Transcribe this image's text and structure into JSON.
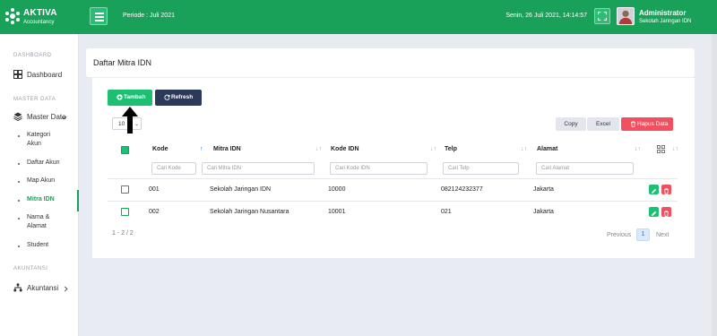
{
  "app": {
    "brand_name": "AKTIVA",
    "brand_sub": "Accountancy",
    "period": "Periode : Juli 2021",
    "datetime": "Senin, 26 Juli 2021, 14:14:57",
    "user_name": "Administrator",
    "user_org": "Sekolah Jaringan IDN",
    "accent_color": "#19a15a"
  },
  "sidebar": {
    "sections": [
      "DASHBOARD",
      "MASTER DATA",
      "AKUNTANSI"
    ],
    "dashboard_label": "Dashboard",
    "master_data_label": "Master Data",
    "sub_items": [
      "Kategori Akun",
      "Daftar Akun",
      "Map Akun",
      "Mitra IDN",
      "Nama & Alamat",
      "Student"
    ],
    "active_item": "Mitra IDN",
    "akuntansi_label": "Akuntansi"
  },
  "page": {
    "title": "Daftar Mitra IDN"
  },
  "toolbar": {
    "add_label": "Tambah",
    "refresh_label": "Refresh",
    "page_length": "10",
    "copy_label": "Copy",
    "excel_label": "Excel",
    "delete_label": "Hapus Data"
  },
  "table": {
    "columns": [
      "Kode",
      "Mitra IDN",
      "Kode IDN",
      "Telp",
      "Alamat"
    ],
    "filters": [
      "Cari Kode",
      "Cari Mitra IDN",
      "Cari Kode IDN",
      "Cari Telp",
      "Cari Alamat"
    ],
    "rows": [
      {
        "kode": "001",
        "mitra": "Sekolah Jaringan IDN",
        "kode_idn": "10000",
        "telp": "082124232377",
        "alamat": "Jakarta"
      },
      {
        "kode": "002",
        "mitra": "Sekolah Jaringan Nusantara",
        "kode_idn": "10001",
        "telp": "021",
        "alamat": "Jakarta"
      }
    ]
  },
  "pagination": {
    "info": "1 - 2 / 2",
    "previous": "Previous",
    "current": "1",
    "next": "Next"
  }
}
